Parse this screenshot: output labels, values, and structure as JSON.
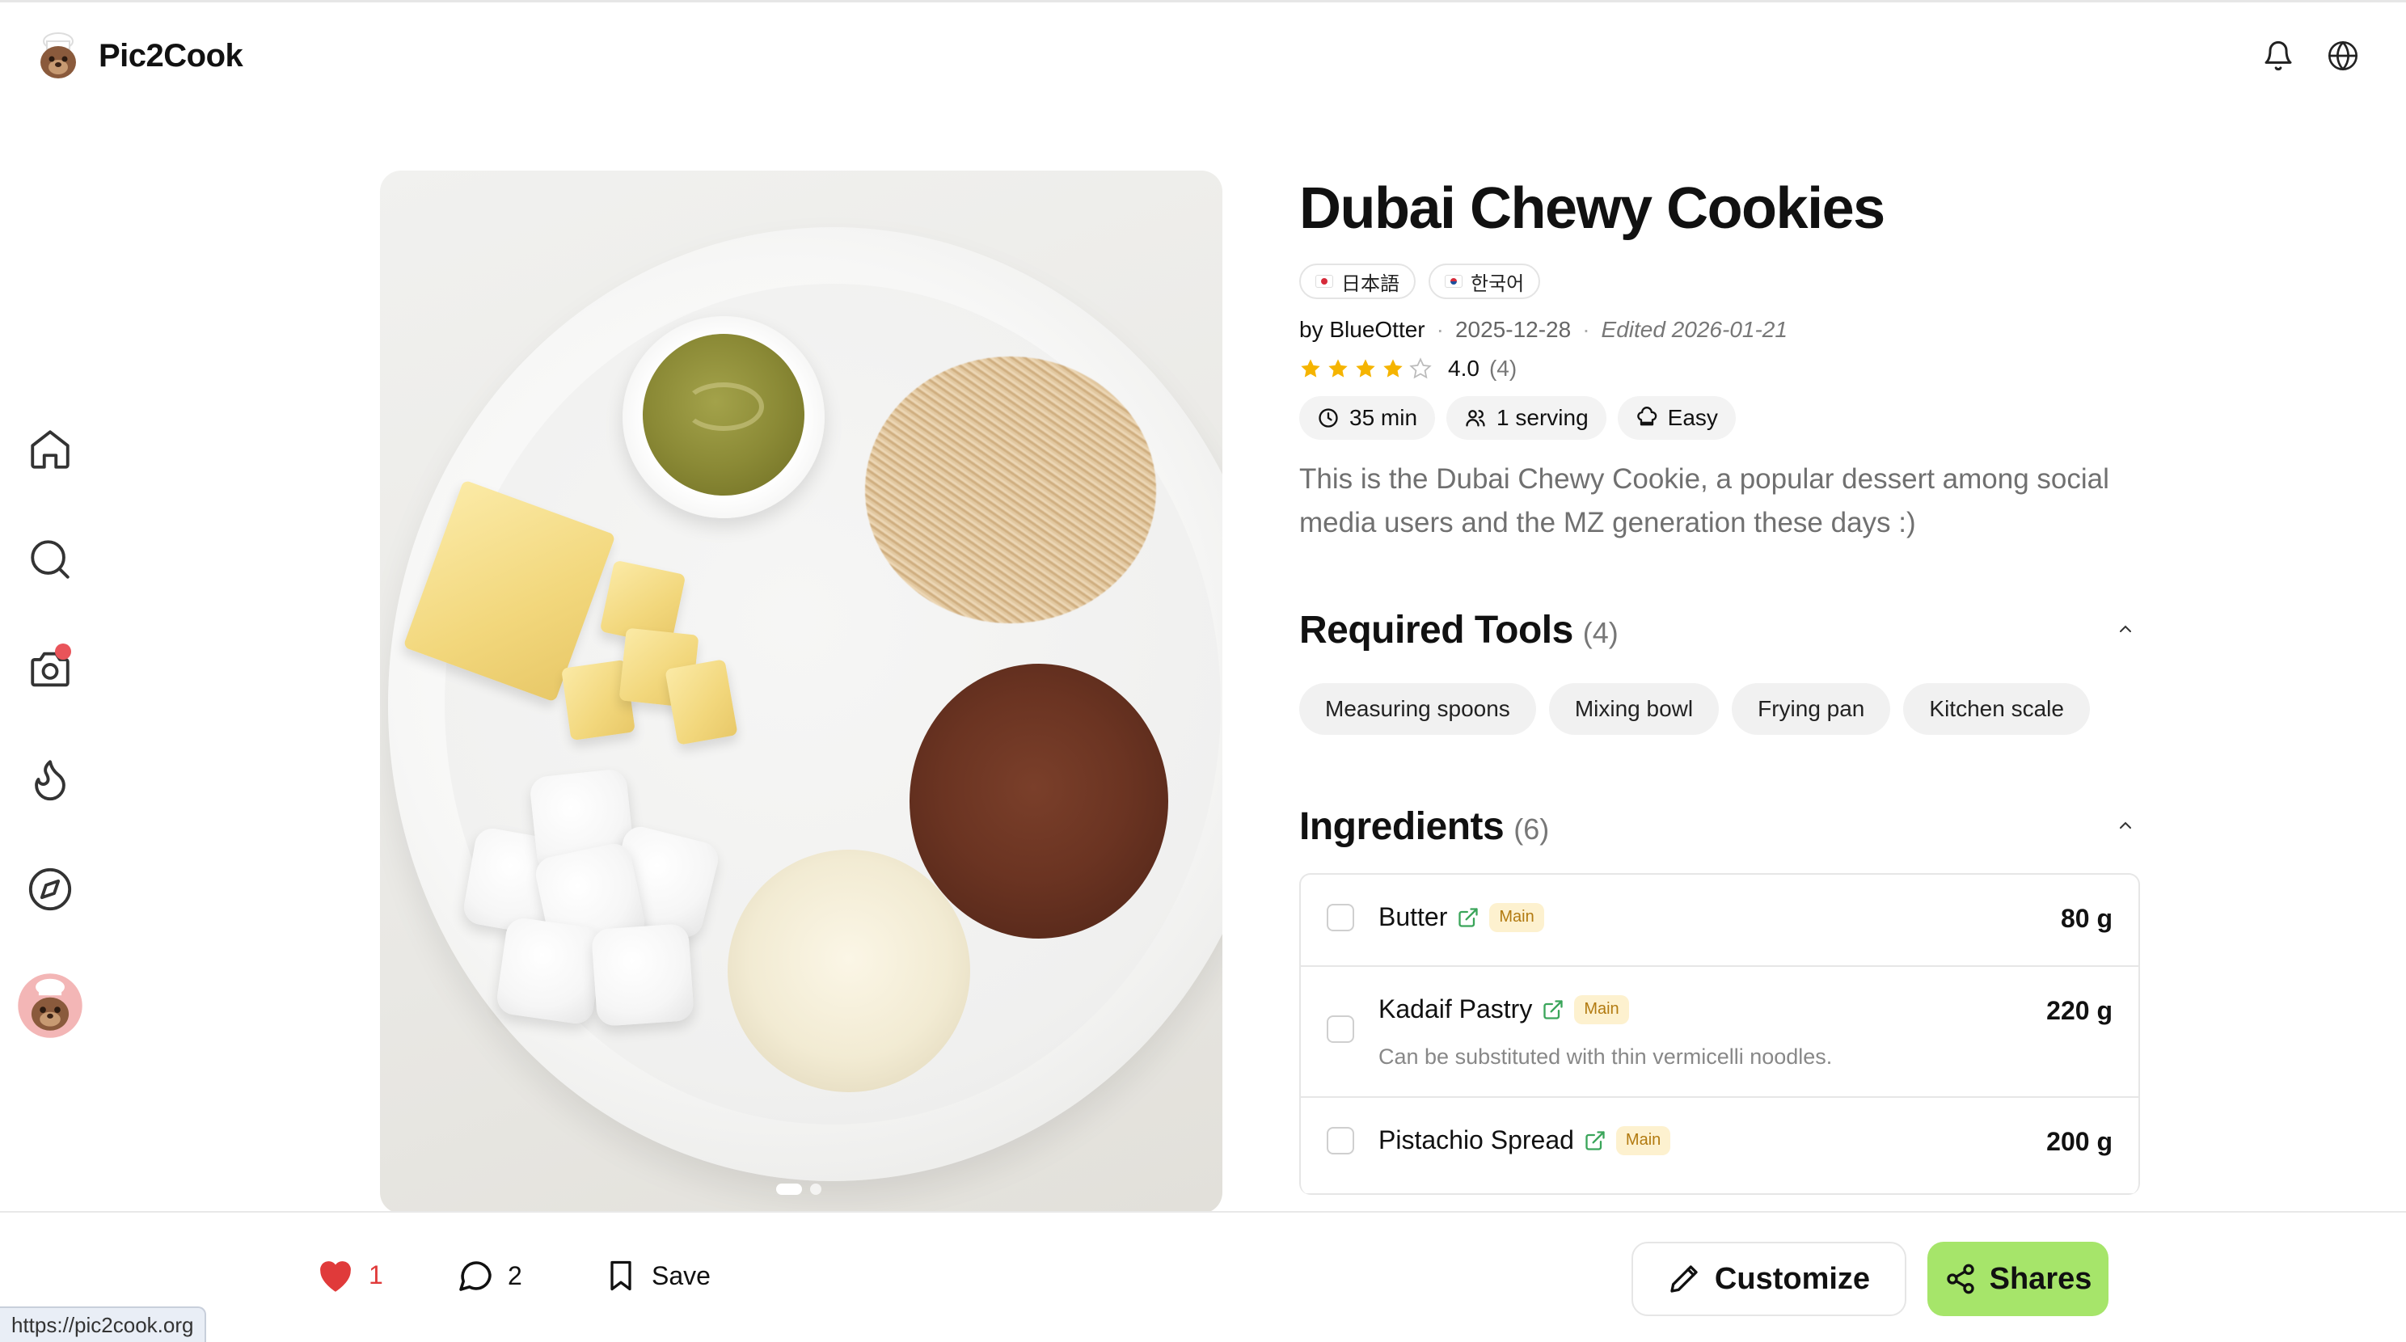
{
  "app": {
    "name": "Pic2Cook"
  },
  "header": {
    "icons": [
      "bell-icon",
      "globe-icon"
    ]
  },
  "sidebar": {
    "items": [
      "home-icon",
      "search-icon",
      "camera-icon",
      "flame-icon",
      "compass-icon",
      "avatar"
    ],
    "camera_has_notification": true
  },
  "recipe": {
    "title": "Dubai Chewy Cookies",
    "languages": [
      {
        "flag": "jp",
        "label": "日本語"
      },
      {
        "flag": "kr",
        "label": "한국어"
      }
    ],
    "author": "by BlueOtter",
    "date": "2025-12-28",
    "edited": "Edited 2026-01-21",
    "rating": {
      "value": "4.0",
      "count": "(4)",
      "stars_filled": 4,
      "stars_total": 5
    },
    "stats": {
      "time": "35 min",
      "servings": "1 serving",
      "difficulty": "Easy"
    },
    "description": "This is the Dubai Chewy Cookie, a popular dessert among social media users and the MZ generation these days :)",
    "image_pages": {
      "current": 1,
      "total": 2
    }
  },
  "tools": {
    "title": "Required Tools",
    "count": "(4)",
    "items": [
      "Measuring spoons",
      "Mixing bowl",
      "Frying pan",
      "Kitchen scale"
    ]
  },
  "ingredients": {
    "title": "Ingredients",
    "count": "(6)",
    "items": [
      {
        "name": "Butter",
        "tag": "Main",
        "qty": "80 g",
        "note": ""
      },
      {
        "name": "Kadaif Pastry",
        "tag": "Main",
        "qty": "220 g",
        "note": "Can be substituted with thin vermicelli noodles."
      },
      {
        "name": "Pistachio Spread",
        "tag": "Main",
        "qty": "200 g",
        "note": ""
      }
    ]
  },
  "actions": {
    "likes": "1",
    "comments": "2",
    "save_label": "Save",
    "customize_label": "Customize",
    "shares_label": "Shares"
  },
  "status_bar": {
    "url": "https://pic2cook.org"
  },
  "colors": {
    "accent_green": "#a6e56a",
    "like_red": "#e03a3a",
    "star_gold": "#f5b400",
    "notification": "#e9545a"
  }
}
